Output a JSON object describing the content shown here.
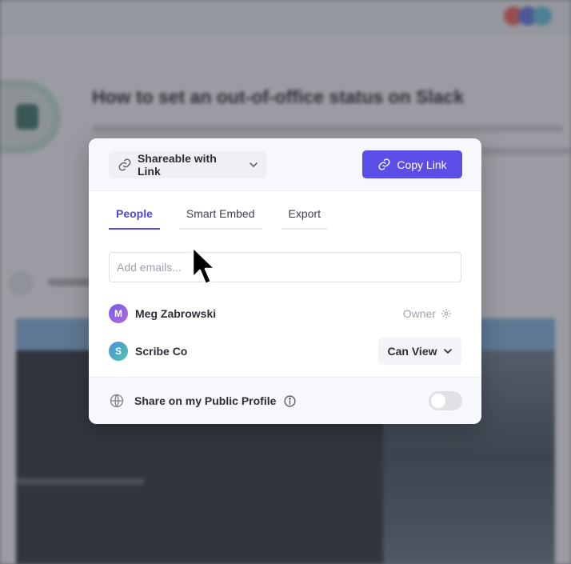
{
  "background": {
    "page_title": "How to set an out-of-office status on Slack"
  },
  "modal": {
    "share_mode": {
      "label": "Shareable with Link",
      "link_icon": "link-icon",
      "chevron_icon": "chevron-down-icon"
    },
    "copy_link": {
      "label": "Copy Link",
      "icon": "link-icon"
    },
    "tabs": [
      {
        "label": "People",
        "active": true
      },
      {
        "label": "Smart Embed",
        "active": false
      },
      {
        "label": "Export",
        "active": false
      }
    ],
    "email_input": {
      "placeholder": "Add emails...",
      "value": ""
    },
    "people": [
      {
        "initial": "M",
        "name": "Meg Zabrowski",
        "role": "Owner",
        "role_icon": "gear-icon"
      },
      {
        "initial": "S",
        "name": "Scribe Co",
        "role": "Can View",
        "role_icon": "chevron-down-icon"
      }
    ],
    "public_profile": {
      "label": "Share on my Public Profile",
      "icon": "globe-icon",
      "info_icon": "info-icon",
      "enabled": false
    }
  },
  "colors": {
    "accent": "#5b4ee6",
    "overlay": "#8d8f95"
  }
}
